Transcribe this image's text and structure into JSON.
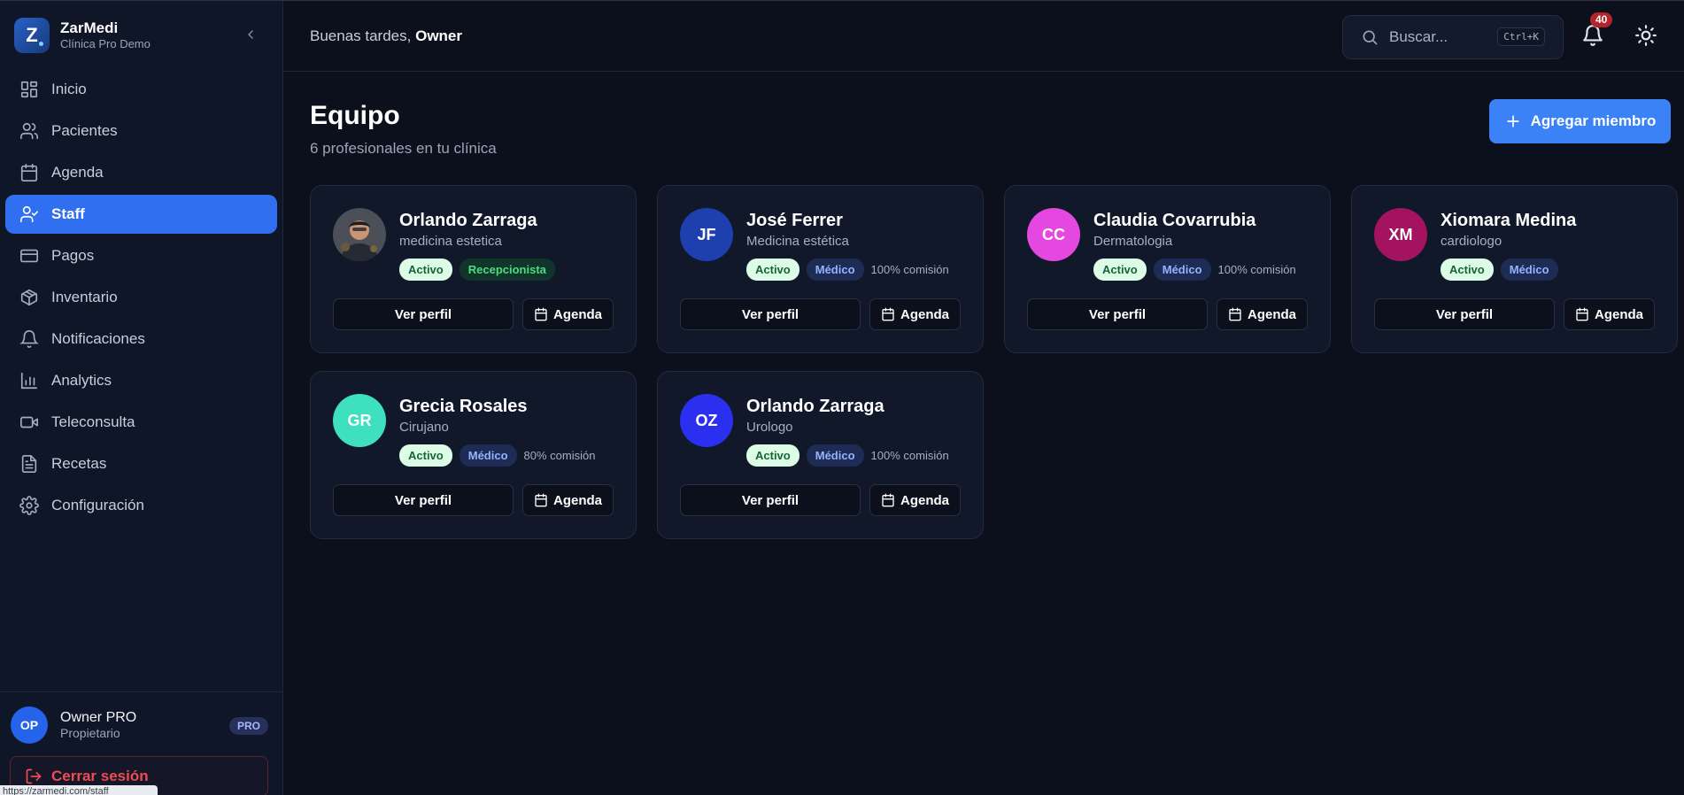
{
  "brand": {
    "name": "ZarMedi",
    "subtitle": "Clínica Pro Demo",
    "logo_letter": "Z"
  },
  "nav": [
    {
      "label": "Inicio",
      "icon": "grid-icon",
      "active": false
    },
    {
      "label": "Pacientes",
      "icon": "users-icon",
      "active": false
    },
    {
      "label": "Agenda",
      "icon": "calendar-icon",
      "active": false
    },
    {
      "label": "Staff",
      "icon": "user-check-icon",
      "active": true
    },
    {
      "label": "Pagos",
      "icon": "credit-card-icon",
      "active": false
    },
    {
      "label": "Inventario",
      "icon": "package-icon",
      "active": false
    },
    {
      "label": "Notificaciones",
      "icon": "bell-icon",
      "active": false
    },
    {
      "label": "Analytics",
      "icon": "bar-chart-icon",
      "active": false
    },
    {
      "label": "Teleconsulta",
      "icon": "video-icon",
      "active": false
    },
    {
      "label": "Recetas",
      "icon": "file-text-icon",
      "active": false
    },
    {
      "label": "Configuración",
      "icon": "gear-icon",
      "active": false
    }
  ],
  "user": {
    "initials": "OP",
    "name": "Owner PRO",
    "role": "Propietario",
    "plan": "PRO"
  },
  "logout_label": "Cerrar sesión",
  "status_url": "https://zarmedi.com/staff",
  "header": {
    "greeting": "Buenas tardes,",
    "greeting_name": "Owner",
    "search_placeholder": "Buscar...",
    "search_shortcut": "Ctrl+K",
    "notifications_count": "40"
  },
  "page": {
    "title": "Equipo",
    "subtitle": "6 profesionales en tu clínica",
    "add_button": "Agregar miembro"
  },
  "staff": [
    {
      "initials": "",
      "photo": true,
      "name": "Orlando Zarraga",
      "specialty": "medicina estetica",
      "status": "Activo",
      "role": "Recepcionista",
      "role_style": "rec",
      "commission": "",
      "color": "#3a3f4a"
    },
    {
      "initials": "JF",
      "photo": false,
      "name": "José Ferrer",
      "specialty": "Medicina estética",
      "status": "Activo",
      "role": "Médico",
      "role_style": "med",
      "commission": "100% comisión",
      "color": "#1e40af"
    },
    {
      "initials": "CC",
      "photo": false,
      "name": "Claudia Covarrubia",
      "specialty": "Dermatologia",
      "status": "Activo",
      "role": "Médico",
      "role_style": "med",
      "commission": "100% comisión",
      "color": "#e548e0"
    },
    {
      "initials": "XM",
      "photo": false,
      "name": "Xiomara Medina",
      "specialty": "cardiologo",
      "status": "Activo",
      "role": "Médico",
      "role_style": "med",
      "commission": "",
      "color": "#a3135f"
    },
    {
      "initials": "GR",
      "photo": false,
      "name": "Grecia Rosales",
      "specialty": "Cirujano",
      "status": "Activo",
      "role": "Médico",
      "role_style": "med",
      "commission": "80% comisión",
      "color": "#3ee0c0"
    },
    {
      "initials": "OZ",
      "photo": false,
      "name": "Orlando Zarraga",
      "specialty": "Urologo",
      "status": "Activo",
      "role": "Médico",
      "role_style": "med",
      "commission": "100% comisión",
      "color": "#2b2ff0"
    }
  ],
  "card_buttons": {
    "profile": "Ver perfil",
    "agenda": "Agenda"
  }
}
